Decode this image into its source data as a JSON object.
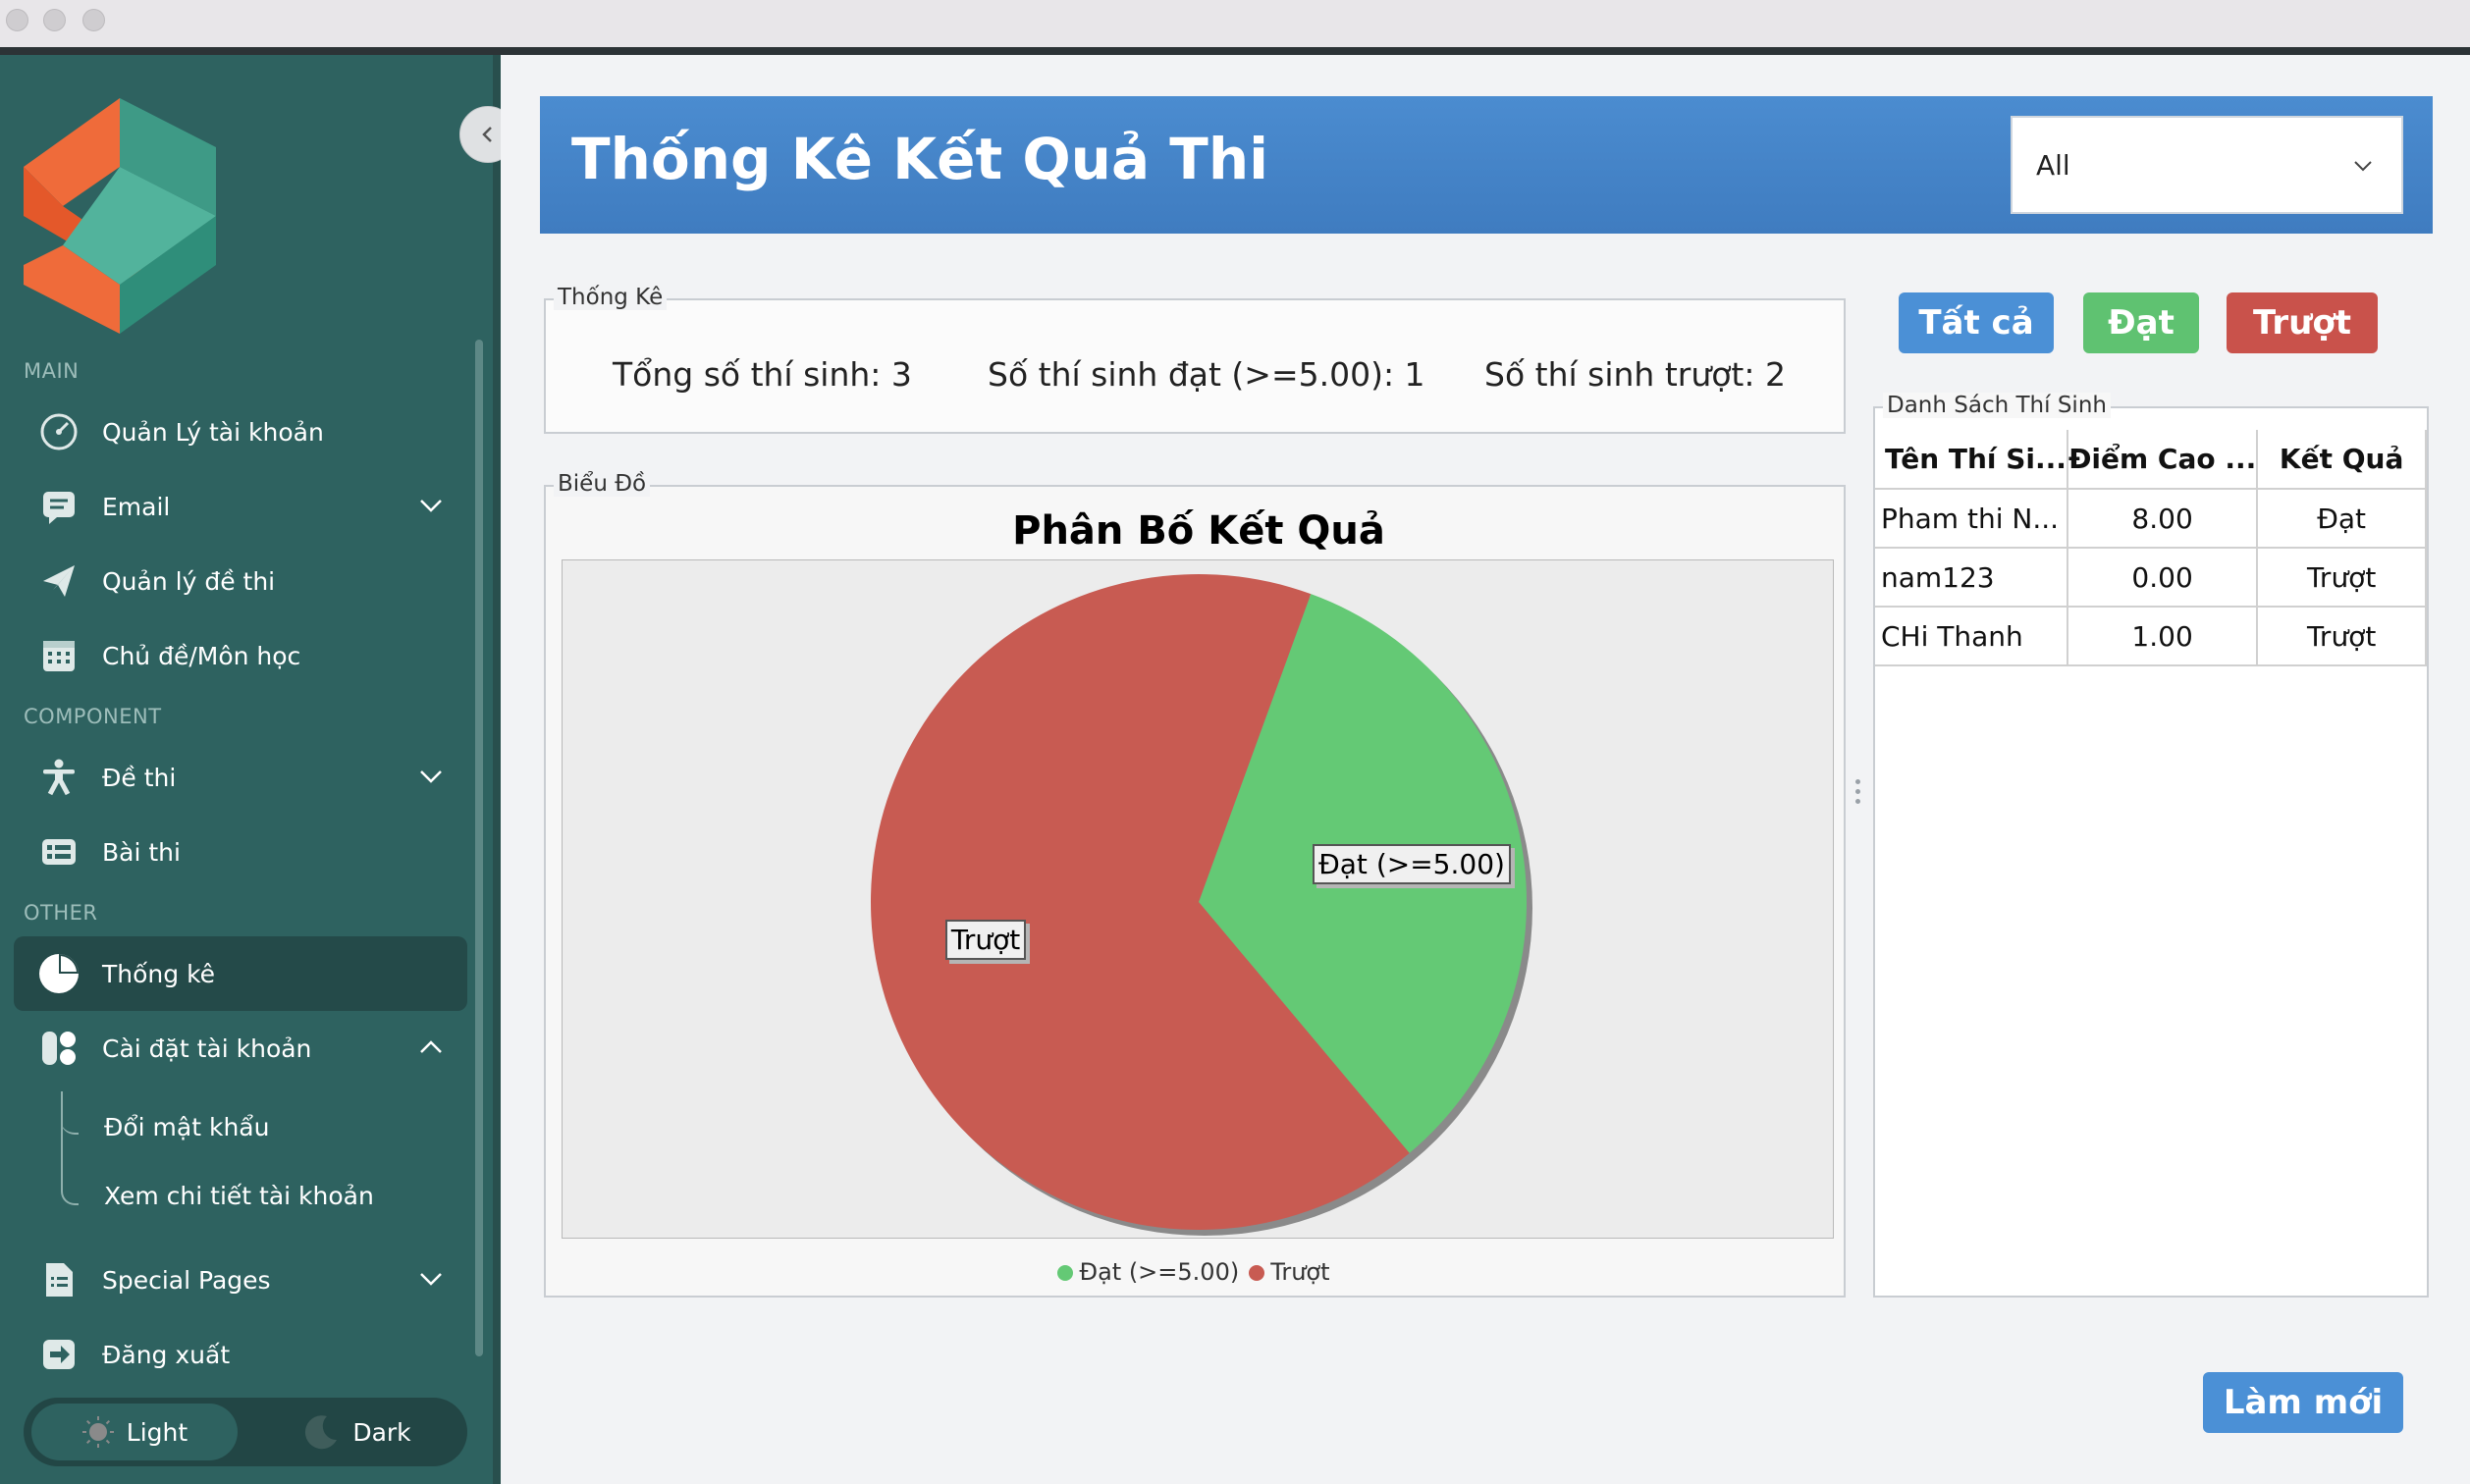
{
  "sidebar": {
    "sections": {
      "main": "MAIN",
      "component": "COMPONENT",
      "other": "OTHER"
    },
    "items": [
      {
        "label": "Quản Lý tài khoản",
        "icon": "dashboard-icon"
      },
      {
        "label": "Email",
        "icon": "email-icon",
        "expandable": true
      },
      {
        "label": "Quản lý đề thi",
        "icon": "send-icon"
      },
      {
        "label": "Chủ đề/Môn học",
        "icon": "calendar-icon"
      },
      {
        "label": "Đề thi",
        "icon": "accessibility-icon",
        "expandable": true
      },
      {
        "label": "Bài thi",
        "icon": "forms-icon"
      },
      {
        "label": "Thống kê",
        "icon": "pie-chart-icon",
        "active": true
      },
      {
        "label": "Cài đặt tài khoản",
        "icon": "settings-blocks-icon",
        "expanded": true
      },
      {
        "label": "Special Pages",
        "icon": "document-icon",
        "expandable": true
      },
      {
        "label": "Đăng xuất",
        "icon": "logout-icon"
      }
    ],
    "subitems": [
      "Đổi mật khẩu",
      "Xem chi tiết tài khoản"
    ],
    "theme": {
      "light": "Light",
      "dark": "Dark",
      "selected": "Light"
    }
  },
  "header": {
    "title": "Thống Kê Kết Quả Thi",
    "filter_value": "All"
  },
  "stats": {
    "legend": "Thống Kê",
    "total": "Tổng số thí sinh: 3",
    "passed": "Số thí sinh đạt (>=5.00): 1",
    "failed": "Số thí sinh trượt: 2"
  },
  "chart_section": {
    "legend": "Biểu Đồ"
  },
  "chart_data": {
    "type": "pie",
    "title": "Phân Bố Kết Quả",
    "categories": [
      "Đạt (>=5.00)",
      "Trượt"
    ],
    "values": [
      1,
      2
    ],
    "colors": [
      "#64c975",
      "#c85b52"
    ],
    "legend_position": "bottom"
  },
  "filters": {
    "all": "Tất cả",
    "pass": "Đạt",
    "fail": "Trượt"
  },
  "filter_colors": {
    "all": "#4b90d6",
    "pass": "#5fc271",
    "fail": "#c9524b"
  },
  "students": {
    "legend": "Danh Sách Thí Sinh",
    "columns": [
      "Tên Thí Si...",
      "Điểm Cao ...",
      "Kết Quả"
    ],
    "rows": [
      [
        "Pham thi N...",
        "8.00",
        "Đạt"
      ],
      [
        "nam123",
        "0.00",
        "Trượt"
      ],
      [
        "CHi Thanh",
        "1.00",
        "Trượt"
      ]
    ]
  },
  "actions": {
    "refresh": "Làm mới"
  }
}
